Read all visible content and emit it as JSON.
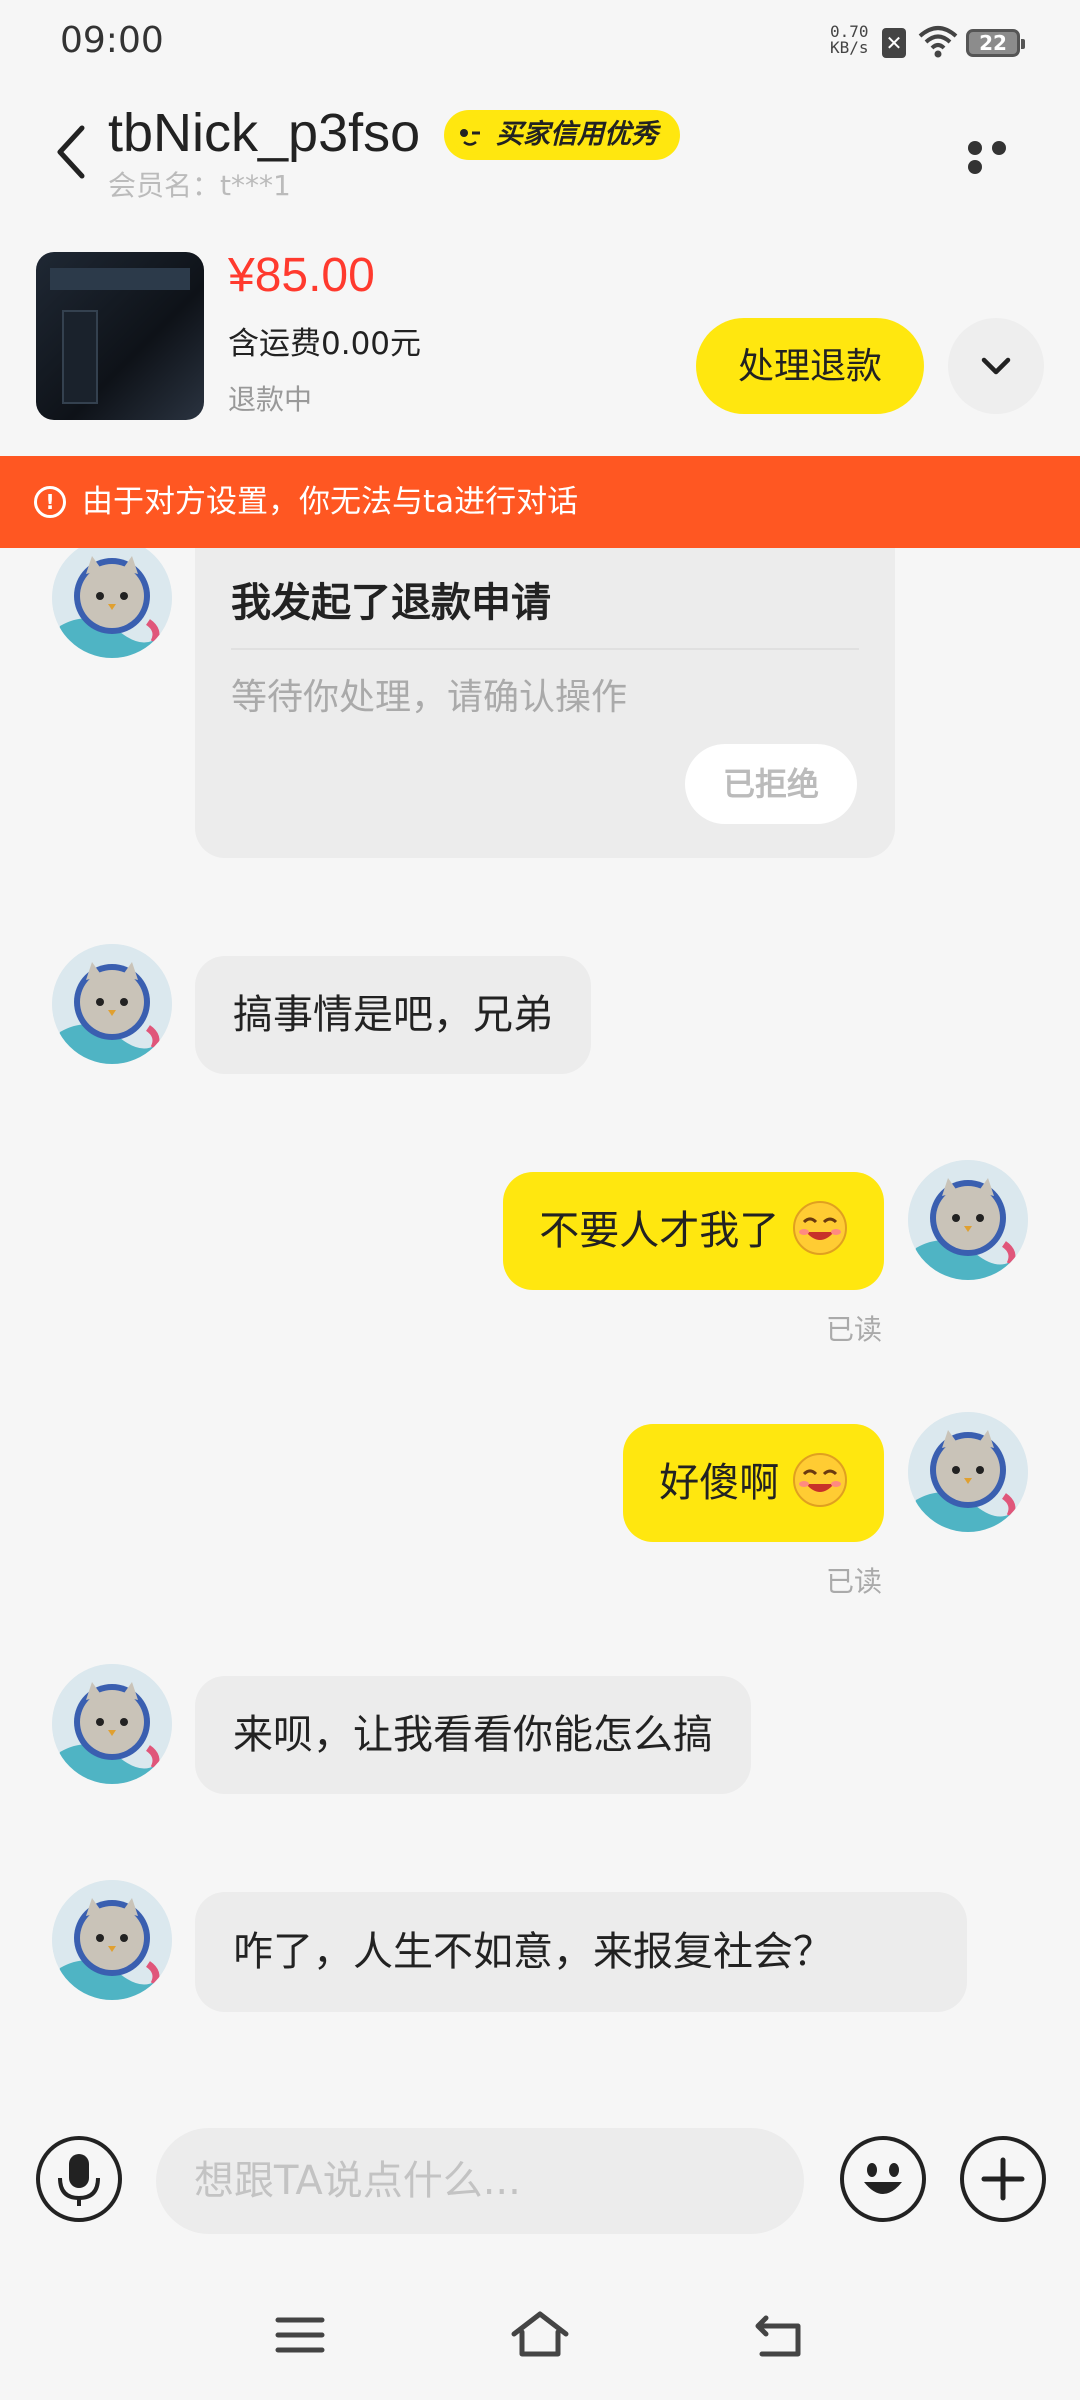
{
  "status": {
    "time": "09:00",
    "speed_value": "0.70",
    "speed_unit": "KB/s",
    "battery": "22"
  },
  "header": {
    "nick": "tbNick_p3fso",
    "badge": "买家信用优秀",
    "member": "会员名：t***1"
  },
  "order": {
    "price": "¥85.00",
    "shipping": "含运费0.00元",
    "status": "退款中",
    "refund_button": "处理退款"
  },
  "alert": {
    "text": "由于对方设置，你无法与ta进行对话"
  },
  "card": {
    "title": "我发起了退款申请",
    "subtitle": "等待你处理，请确认操作",
    "button": "已拒绝"
  },
  "messages": [
    {
      "side": "in",
      "text": "搞事情是吧，兄弟"
    },
    {
      "side": "out",
      "text": "不要人才我了",
      "status": "已读"
    },
    {
      "side": "out",
      "text": "好傻啊",
      "status": "已读"
    },
    {
      "side": "in",
      "text": "来呗，让我看看你能怎么搞"
    },
    {
      "side": "in",
      "text": "咋了，人生不如意，来报复社会？"
    }
  ],
  "input": {
    "placeholder": "想跟TA说点什么..."
  },
  "colors": {
    "accent": "#ffe70f",
    "alert": "#ff5722",
    "price": "#ff3a2e"
  }
}
